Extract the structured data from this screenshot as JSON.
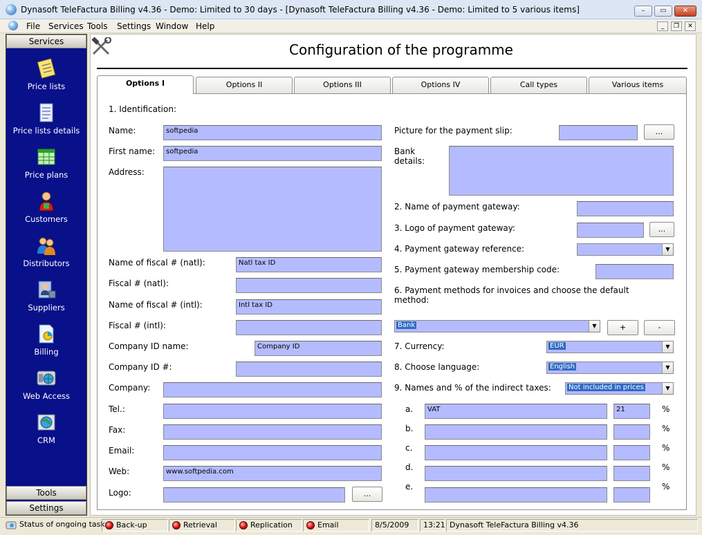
{
  "window": {
    "title": "Dynasoft TeleFactura Billing v4.36 - Demo: Limited to 30 days - [Dynasoft TeleFactura Billing v4.36 - Demo: Limited to 5 various items]"
  },
  "menu": [
    "File",
    "Services",
    "Tools",
    "Settings",
    "Window",
    "Help"
  ],
  "sidebar": {
    "header": "Services",
    "items": [
      {
        "label": "Price lists",
        "icon": "price-lists-icon"
      },
      {
        "label": "Price lists details",
        "icon": "price-lists-details-icon"
      },
      {
        "label": "Price plans",
        "icon": "price-plans-icon"
      },
      {
        "label": "Customers",
        "icon": "customers-icon"
      },
      {
        "label": "Distributors",
        "icon": "distributors-icon"
      },
      {
        "label": "Suppliers",
        "icon": "suppliers-icon"
      },
      {
        "label": "Billing",
        "icon": "billing-icon"
      },
      {
        "label": "Web Access",
        "icon": "web-access-icon"
      },
      {
        "label": "CRM",
        "icon": "crm-icon"
      }
    ],
    "tools": "Tools",
    "settings": "Settings"
  },
  "page": {
    "title": "Configuration of the programme"
  },
  "tabs": [
    "Options I",
    "Options II",
    "Options III",
    "Options IV",
    "Call types",
    "Various items"
  ],
  "left": {
    "section": "1. Identification:",
    "name_label": "Name:",
    "name_value": "softpedia",
    "firstname_label": "First name:",
    "firstname_value": "softpedia",
    "address_label": "Address:",
    "fiscal_natl_name_label": "Name of fiscal # (natl):",
    "fiscal_natl_name_value": "Natl tax ID",
    "fiscal_natl_label": "Fiscal # (natl):",
    "fiscal_intl_name_label": "Name of fiscal # (intl):",
    "fiscal_intl_name_value": "Intl tax ID",
    "fiscal_intl_label": "Fiscal # (intl):",
    "company_id_name_label": "Company ID name:",
    "company_id_name_value": "Company ID",
    "company_id_label": "Company ID #:",
    "company_label": "Company:",
    "tel_label": "Tel.:",
    "fax_label": "Fax:",
    "email_label": "Email:",
    "web_label": "Web:",
    "web_value": "www.softpedia.com",
    "logo_label": "Logo:",
    "browse": "..."
  },
  "right": {
    "picture_label": "Picture for the payment slip:",
    "bank_label_1": "Bank",
    "bank_label_2": "details:",
    "gateway_name_label": "2. Name of payment gateway:",
    "gateway_logo_label": "3. Logo of payment gateway:",
    "gateway_ref_label": "4. Payment gateway reference:",
    "gateway_code_label": "5. Payment gateway membership code:",
    "methods_label_1": "6. Payment methods for invoices and choose the default",
    "methods_label_2": "method:",
    "method_value": "Bank",
    "plus": "+",
    "minus": "-",
    "currency_label": "7. Currency:",
    "currency_value": "EUR",
    "language_label": "8. Choose language:",
    "language_value": "English",
    "taxes_label": "9. Names and % of the indirect taxes:",
    "taxes_mode": "Not included in prices",
    "tax_rows": [
      {
        "letter": "a.",
        "name": "VAT",
        "pct": "21"
      },
      {
        "letter": "b.",
        "name": "",
        "pct": ""
      },
      {
        "letter": "c.",
        "name": "",
        "pct": ""
      },
      {
        "letter": "d.",
        "name": "",
        "pct": ""
      },
      {
        "letter": "e.",
        "name": "",
        "pct": ""
      }
    ],
    "pct_sign": "%",
    "browse": "..."
  },
  "status": {
    "label": "Status of ongoing tasks:",
    "backup": "Back-up",
    "retrieval": "Retrieval",
    "replication": "Replication",
    "email": "Email",
    "date": "8/5/2009",
    "time": "13:21",
    "app": "Dynasoft TeleFactura Billing v4.36"
  },
  "colors": {
    "sidebar": "#08108a",
    "field": "#b4bcff",
    "selection": "#316ac5"
  }
}
